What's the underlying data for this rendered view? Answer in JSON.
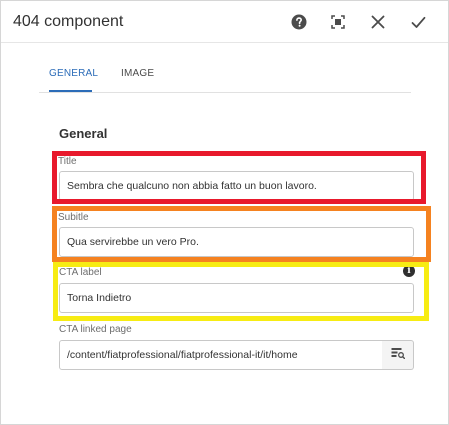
{
  "dialog": {
    "title": "404 component",
    "actions": {
      "help_icon": "help-icon",
      "fullscreen_icon": "fullscreen-icon",
      "close_icon": "close-icon",
      "done_icon": "check-icon"
    }
  },
  "tabs": [
    {
      "label": "GENERAL",
      "active": true
    },
    {
      "label": "IMAGE",
      "active": false
    }
  ],
  "section": {
    "title": "General"
  },
  "fields": {
    "title": {
      "label": "Title",
      "value": "Sembra che qualcuno non abbia fatto un buon lavoro."
    },
    "subtitle": {
      "label": "Subitle",
      "value": "Qua servirebbe un vero Pro."
    },
    "cta_label": {
      "label": "CTA label",
      "value": "Torna Indietro",
      "info_icon": "info-icon"
    },
    "cta_link": {
      "label": "CTA linked page",
      "value": "/content/fiatprofessional/fiatprofessional-it/it/home",
      "browse_icon": "path-browse-icon"
    }
  },
  "highlights": {
    "title_color": "#e8192c",
    "subtitle_color": "#f58220",
    "cta_label_color": "#f7ec13"
  },
  "colors": {
    "accent": "#2c6cb8"
  }
}
